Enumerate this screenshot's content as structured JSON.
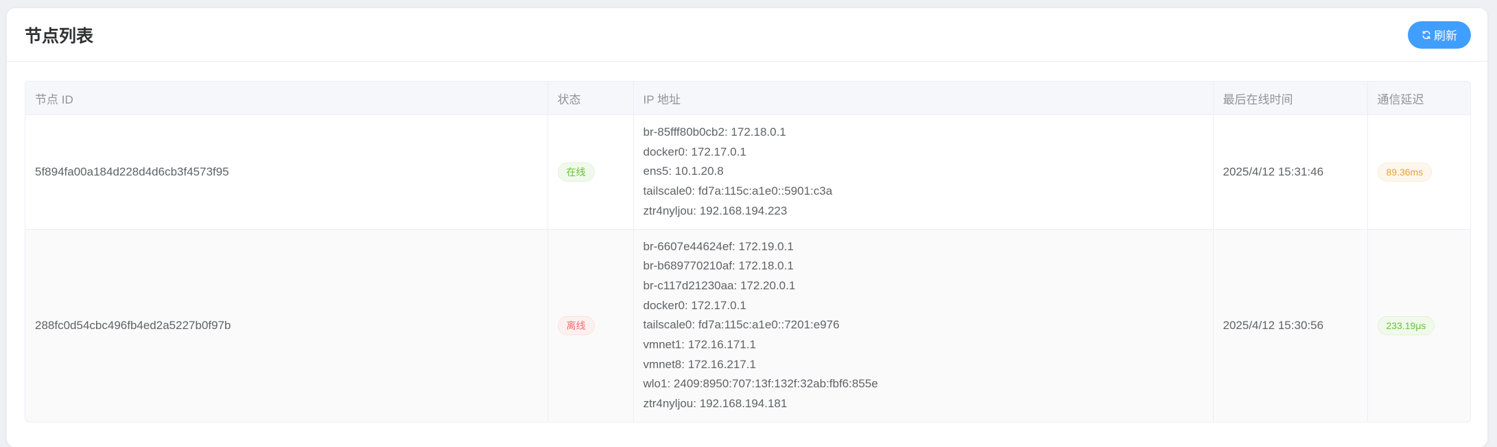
{
  "header": {
    "title": "节点列表",
    "refresh_label": "刷新"
  },
  "table": {
    "columns": [
      "节点 ID",
      "状态",
      "IP 地址",
      "最后在线时间",
      "通信延迟"
    ],
    "rows": [
      {
        "node_id": "5f894fa00a184d228d4d6cb3f4573f95",
        "status": "在线",
        "ips": [
          "br-85fff80b0cb2: 172.18.0.1",
          "docker0: 172.17.0.1",
          "ens5: 10.1.20.8",
          "tailscale0: fd7a:115c:a1e0::5901:c3a",
          "ztr4nyljou: 192.168.194.223"
        ],
        "last_online": "2025/4/12 15:31:46",
        "latency": "89.36ms"
      },
      {
        "node_id": "288fc0d54cbc496fb4ed2a5227b0f97b",
        "status": "离线",
        "ips": [
          "br-6607e44624ef: 172.19.0.1",
          "br-b689770210af: 172.18.0.1",
          "br-c117d21230aa: 172.20.0.1",
          "docker0: 172.17.0.1",
          "tailscale0: fd7a:115c:a1e0::7201:e976",
          "vmnet1: 172.16.171.1",
          "vmnet8: 172.16.217.1",
          "wlo1: 2409:8950:707:13f:132f:32ab:fbf6:855e",
          "ztr4nyljou: 192.168.194.181"
        ],
        "last_online": "2025/4/12 15:30:56",
        "latency": "233.19μs"
      }
    ]
  },
  "colors": {
    "accent": "#409eff",
    "online": "#67c23a",
    "offline": "#f56c6c",
    "warning": "#e6a23c"
  }
}
